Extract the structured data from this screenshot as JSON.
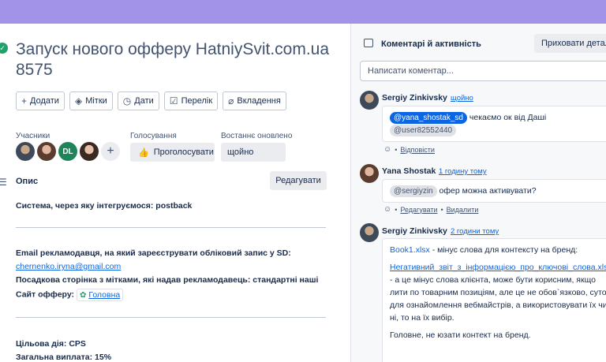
{
  "card": {
    "title": "Запуск нового офферу HatniySvit.com.ua 8575",
    "actions": [
      {
        "icon": "plus-icon",
        "glyph": "+",
        "label": "Додати"
      },
      {
        "icon": "tag-icon",
        "glyph": "◈",
        "label": "Мітки"
      },
      {
        "icon": "clock-icon",
        "glyph": "◷",
        "label": "Дати"
      },
      {
        "icon": "checklist-icon",
        "glyph": "☑",
        "label": "Перелік"
      },
      {
        "icon": "paperclip-icon",
        "glyph": "⌀",
        "label": "Вкладення"
      }
    ],
    "members_label": "Учасники",
    "member_initials": "DL",
    "votes_label": "Голосування",
    "vote_button": "Проголосувати",
    "updated_label": "Востаннє оновлено",
    "updated_value": "щойно",
    "description_label": "Опис",
    "edit_button": "Редагувати",
    "desc": {
      "line1": "Система, через яку інтегруємося: postback",
      "line2": "Email рекламодавця, на який зареєструвати обліковий запис у SD:",
      "email": "chernenko.iryna@gmail.com",
      "line3": "Посадкова сторінка з мітками, які надав рекламодавець: стандартні наші",
      "site_label": "Сайт офферу:",
      "site_link": "Головна",
      "line4": "Цільова дія: CPS",
      "line5": "Загальна виплата: 15%"
    }
  },
  "activity": {
    "title": "Коментарі й активність",
    "hide_button": "Приховати деталі",
    "comment_placeholder": "Написати коментар...",
    "comments": [
      {
        "author": "Sergiy Zinkivsky",
        "time": "щойно",
        "mention1": "@yana_shostak_sd",
        "text1": "чекаємо ок від Даші",
        "mention2": "@user82552440",
        "actions": [
          "Відповісти"
        ]
      },
      {
        "author": "Yana Shostak",
        "time": "1 годину тому",
        "mention1": "@sergiyzin",
        "text1": "офер можна активувати?",
        "actions": [
          "Редагувати",
          "Видалити"
        ]
      },
      {
        "author": "Sergiy Zinkivsky",
        "time": "2 години тому",
        "link1": "Book1.xlsx",
        "text1": " - мінус слова для контексту на бренд:",
        "link2": "Негативний_звіт_з_інформацією_про_ключові_слова.xlsx",
        "text2": "- а це мінус слова клієнта, може бути корисним, якщо лити по товарним позиціям, але це не обов`язково, суто для ознайомлення вебмайстрів, а використовувати їх чи ні, то на їх вибір.",
        "text3": "Головне, не юзати контект на бренд."
      }
    ]
  }
}
